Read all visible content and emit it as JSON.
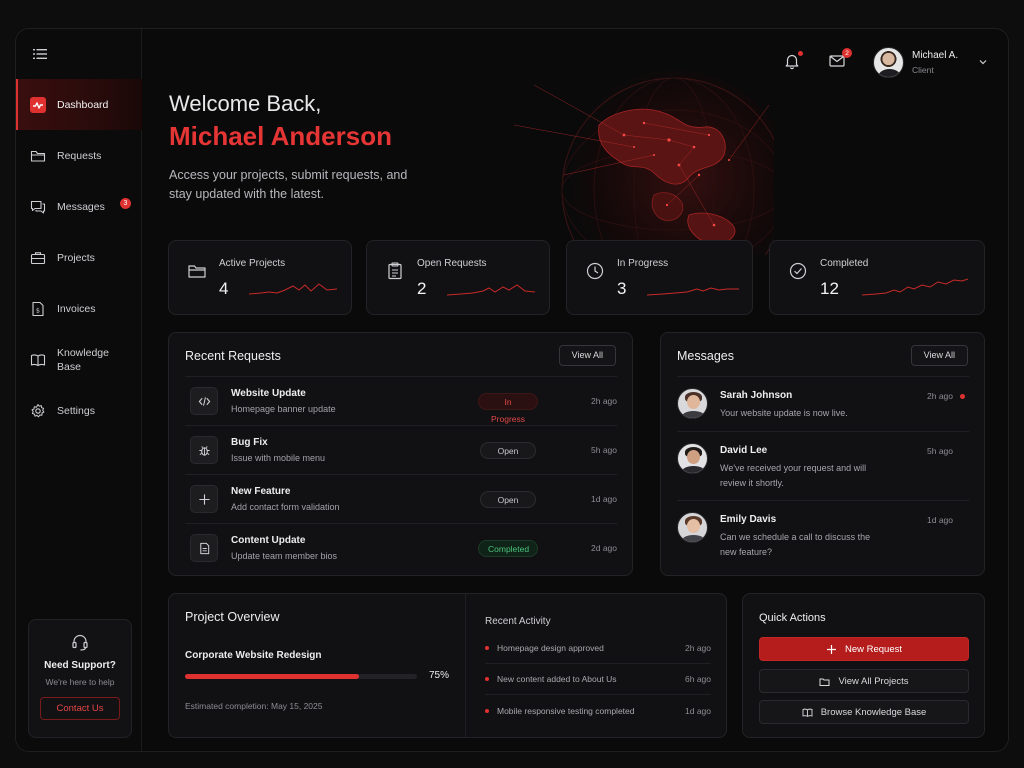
{
  "sidebar": {
    "items": [
      {
        "label": "Dashboard",
        "icon": "pulse-icon"
      },
      {
        "label": "Requests",
        "icon": "folder-icon"
      },
      {
        "label": "Messages",
        "icon": "chat-icon",
        "badge": "3"
      },
      {
        "label": "Projects",
        "icon": "briefcase-icon"
      },
      {
        "label": "Invoices",
        "icon": "invoice-icon"
      },
      {
        "label": "Knowledge Base",
        "icon": "book-icon"
      },
      {
        "label": "Settings",
        "icon": "gear-icon"
      }
    ],
    "support": {
      "title": "Need Support?",
      "subtitle": "We're here to help",
      "button": "Contact Us"
    }
  },
  "header": {
    "mail_badge": "2",
    "user_name": "Michael A.",
    "user_role": "Client"
  },
  "hero": {
    "greeting": "Welcome Back,",
    "name": "Michael Anderson",
    "tagline": "Access your projects, submit requests, and stay updated with the latest."
  },
  "stats": [
    {
      "label": "Active Projects",
      "value": "4"
    },
    {
      "label": "Open Requests",
      "value": "2"
    },
    {
      "label": "In Progress",
      "value": "3"
    },
    {
      "label": "Completed",
      "value": "12"
    }
  ],
  "recent_requests": {
    "title": "Recent Requests",
    "view_all": "View All",
    "rows": [
      {
        "title": "Website Update",
        "subtitle": "Homepage banner update",
        "status": "In Progress",
        "time": "2h ago"
      },
      {
        "title": "Bug Fix",
        "subtitle": "Issue with mobile menu",
        "status": "Open",
        "time": "5h ago"
      },
      {
        "title": "New Feature",
        "subtitle": "Add contact form validation",
        "status": "Open",
        "time": "1d ago"
      },
      {
        "title": "Content Update",
        "subtitle": "Update team member bios",
        "status": "Completed",
        "time": "2d ago"
      }
    ]
  },
  "messages": {
    "title": "Messages",
    "view_all": "View All",
    "rows": [
      {
        "name": "Sarah Johnson",
        "body": "Your website update is now live.",
        "time": "2h ago"
      },
      {
        "name": "David Lee",
        "body": "We've received your request and will review it shortly.",
        "time": "5h ago"
      },
      {
        "name": "Emily Davis",
        "body": "Can we schedule a call to discuss the new feature?",
        "time": "1d ago"
      }
    ]
  },
  "project_overview": {
    "title": "Project Overview",
    "project": "Corporate Website Redesign",
    "progress": 75,
    "progress_label": "75%",
    "estimate": "Estimated completion: May 15, 2025",
    "activity_title": "Recent Activity",
    "activity": [
      {
        "text": "Homepage design approved",
        "time": "2h ago"
      },
      {
        "text": "New content added to About Us",
        "time": "6h ago"
      },
      {
        "text": "Mobile responsive testing completed",
        "time": "1d ago"
      }
    ]
  },
  "quick_actions": {
    "title": "Quick Actions",
    "new_request": "New Request",
    "view_projects": "View All Projects",
    "browse_kb": "Browse Knowledge Base"
  },
  "colors": {
    "accent": "#e03131",
    "background": "#0a0a0b",
    "panel": "#111113",
    "success": "#4bc27a"
  }
}
